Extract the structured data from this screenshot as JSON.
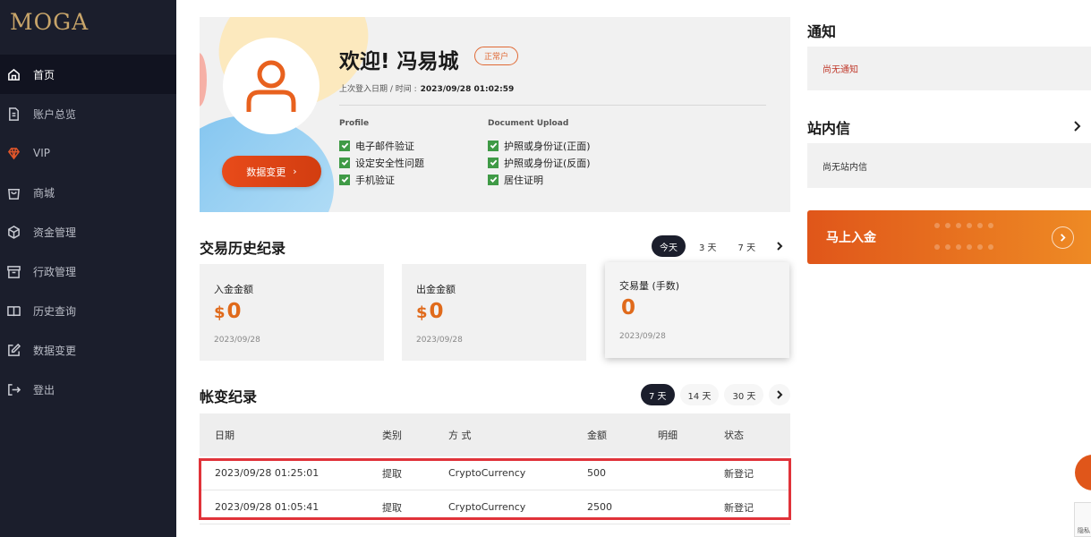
{
  "sidebar": {
    "logo": "MOGA",
    "items": [
      {
        "label": "首页",
        "icon": "home-icon"
      },
      {
        "label": "账户总览",
        "icon": "document-icon"
      },
      {
        "label": "VIP",
        "icon": "diamond-icon"
      },
      {
        "label": "商城",
        "icon": "shopping-bag-icon"
      },
      {
        "label": "资金管理",
        "icon": "cube-icon"
      },
      {
        "label": "行政管理",
        "icon": "archive-box-icon"
      },
      {
        "label": "历史查询",
        "icon": "book-icon"
      },
      {
        "label": "数据变更",
        "icon": "edit-icon"
      },
      {
        "label": "登出",
        "icon": "logout-icon"
      }
    ]
  },
  "profile": {
    "welcome": "欢迎! 冯易城",
    "status_badge": "正常户",
    "last_login_label": "上次登入日期 / 时间 :",
    "last_login_value": "2023/09/28 01:02:59",
    "edit_button": "数据变更",
    "profile_title": "Profile",
    "profile_checks": [
      "电子邮件验证",
      "设定安全性问题",
      "手机验证"
    ],
    "doc_title": "Document Upload",
    "doc_checks": [
      "护照或身份证(正面)",
      "护照或身份证(反面)",
      "居住证明"
    ]
  },
  "history": {
    "title": "交易历史纪录",
    "filters": [
      "今天",
      "3 天",
      "7 天"
    ],
    "cards": [
      {
        "label": "入金金额",
        "currency": "$",
        "value": "0",
        "date": "2023/09/28"
      },
      {
        "label": "出金金额",
        "currency": "$",
        "value": "0",
        "date": "2023/09/28"
      },
      {
        "label": "交易量 (手数)",
        "currency": "",
        "value": "0",
        "date": "2023/09/28"
      }
    ]
  },
  "ledger": {
    "title": "帐变纪录",
    "filters": [
      "7 天",
      "14 天",
      "30 天"
    ],
    "columns": [
      "日期",
      "类别",
      "方 式",
      "金额",
      "明细",
      "状态"
    ],
    "rows": [
      [
        "2023/09/28 01:25:01",
        "提取",
        "CryptoCurrency",
        "500",
        "",
        "新登记"
      ],
      [
        "2023/09/28 01:05:41",
        "提取",
        "CryptoCurrency",
        "2500",
        "",
        "新登记"
      ]
    ]
  },
  "notices": {
    "title": "通知",
    "empty": "尚无通知"
  },
  "inbox": {
    "title": "站内信",
    "empty": "尚无站内信"
  },
  "deposit": {
    "label": "马上入金"
  },
  "recaptcha": {
    "label": "隐私"
  },
  "colors": {
    "sidebar": "#1b1e2c",
    "accent": "#e06a1b",
    "highlight": "#e0333a",
    "check": "#3f9a46"
  }
}
